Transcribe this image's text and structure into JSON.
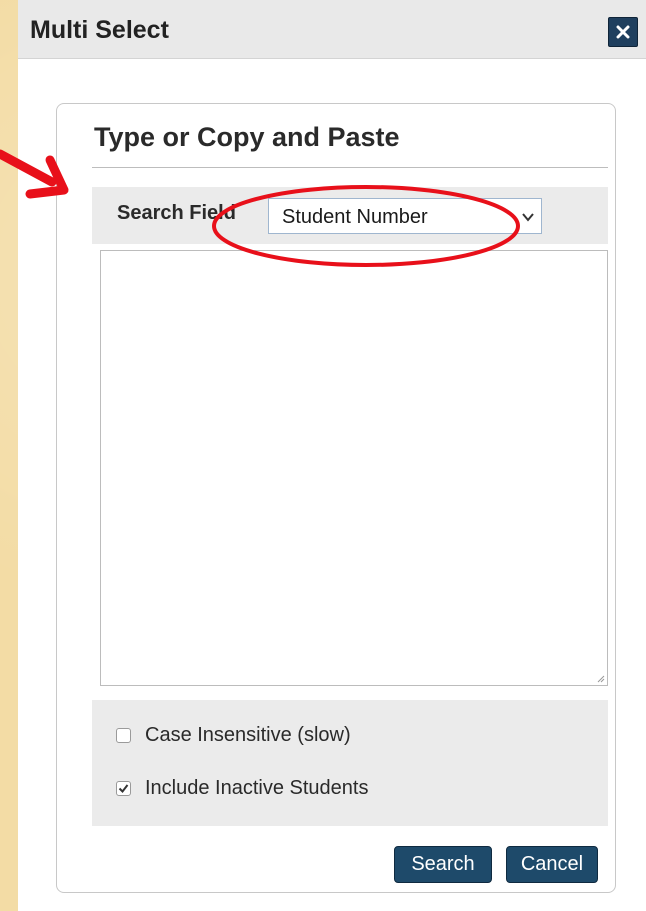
{
  "dialog": {
    "title": "Multi Select",
    "close_icon": "close-icon"
  },
  "panel": {
    "title": "Type or Copy and Paste",
    "search_field": {
      "label": "Search Field",
      "selected": "Student Number",
      "icon": "chevron-down-icon"
    },
    "textarea_value": "",
    "options": [
      {
        "label": "Case Insensitive (slow)",
        "checked": false
      },
      {
        "label": "Include Inactive Students",
        "checked": true
      }
    ],
    "buttons": {
      "search": "Search",
      "cancel": "Cancel"
    }
  },
  "colors": {
    "annotation": "#e8101a",
    "button": "#1e4a6a",
    "background": "#f3dca5"
  }
}
